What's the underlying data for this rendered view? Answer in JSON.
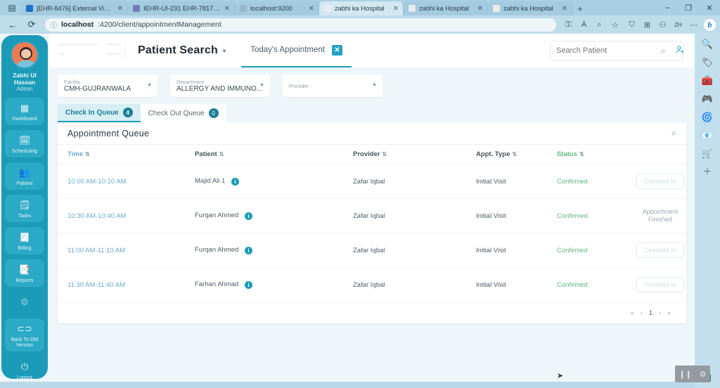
{
  "browser": {
    "tabs": [
      {
        "title": "[EHR-8476] External Visit R...",
        "favicon": "#1a73c8",
        "active": false
      },
      {
        "title": "IEHR-UI-231 EHR-7817 > I...",
        "favicon": "#6f7fb5",
        "active": false
      },
      {
        "title": "localhost:9200",
        "favicon": "#9ab5c7",
        "active": false
      },
      {
        "title": "zabhi ka Hospital",
        "favicon": "#e8edf0",
        "active": true
      },
      {
        "title": "zabhi ka Hospital",
        "favicon": "#e8edf0",
        "active": false
      },
      {
        "title": "zabhi ka Hospital",
        "favicon": "#e8edf0",
        "active": false
      }
    ],
    "new_tab_label": "+",
    "window_controls": [
      "–",
      "❐",
      "✕"
    ],
    "back_icon": "←",
    "reload_icon": "⟳",
    "info_icon": "ⓘ",
    "url_host": "localhost",
    "url_path": ":4200/client/appointmentManagement",
    "omnibox_icons": [
      "⚿",
      "A",
      "⌕",
      "☆"
    ],
    "toolbar_icons": [
      "⛉",
      "⊞",
      "⚇",
      "ZH",
      "⋯"
    ],
    "bing_label": "b"
  },
  "edge_sidebar": {
    "icons": [
      "🔍",
      "🏷",
      "🧰",
      "🎮",
      "🌀",
      "📧",
      "🛒",
      "＋"
    ]
  },
  "appnav": {
    "user_name_line1": "Zabhi Ul",
    "user_name_line2": "Hassan",
    "user_role": "Admin",
    "items": [
      {
        "label": "Dashboard",
        "icon": "▦",
        "boxed": true
      },
      {
        "label": "Scheduling",
        "icon": "🗓",
        "boxed": true
      },
      {
        "label": "Patient",
        "icon": "👥",
        "boxed": true
      },
      {
        "label": "Tasks",
        "icon": "🗒",
        "boxed": true
      },
      {
        "label": "Billing",
        "icon": "🧾",
        "boxed": true
      },
      {
        "label": "Reports",
        "icon": "📑",
        "boxed": true
      },
      {
        "label": "",
        "icon": "⚙",
        "boxed": false
      },
      {
        "label": "Back To Old Version",
        "icon": "⏻",
        "boxed": true
      },
      {
        "label": "Logout",
        "icon": "⏻",
        "boxed": false
      }
    ]
  },
  "topbar": {
    "page_title": "Patient Search",
    "title_caret": "▾",
    "todays_appointment_label": "Today's Appointment",
    "todays_appointment_close": "✕",
    "search_placeholder": "Search Patient",
    "search_value": "",
    "search_icon": "⌕",
    "add_patient_icon": "👤"
  },
  "filters": [
    {
      "label": "Facility",
      "value": "CMH-GUJRANWALA",
      "caret": "▼"
    },
    {
      "label": "Department",
      "value": "ALLERGY AND IMMUNO...",
      "caret": "▼"
    },
    {
      "label": "Provider",
      "value": "",
      "caret": "▼"
    }
  ],
  "queue_tabs": [
    {
      "label": "Check In Queue",
      "count": "4",
      "active": true
    },
    {
      "label": "Check Out Queue",
      "count": "0",
      "active": false
    }
  ],
  "card": {
    "title": "Appointment Queue",
    "search_icon": "⌕"
  },
  "table": {
    "columns": [
      "Time",
      "Patient",
      "Provider",
      "Appt. Type",
      "Status",
      ""
    ],
    "sort_glyph": "⇅",
    "info_glyph": "i",
    "rows": [
      {
        "time": "10:00 AM-10:10 AM",
        "patient": "Majid Ali 1",
        "provider": "Zafar Iqbal",
        "type": "Initial Visit",
        "status": "Confirmed",
        "action_kind": "button",
        "action": "Checked In"
      },
      {
        "time": "10:30 AM-10:40 AM",
        "patient": "Furqan Ahmed",
        "provider": "Zafar Iqbal",
        "type": "Initial Visit",
        "status": "Confirmed",
        "action_kind": "text",
        "action": "Appointment Finished"
      },
      {
        "time": "11:00 AM-11:10 AM",
        "patient": "Furqan Ahmed",
        "provider": "Zafar Iqbal",
        "type": "Initial Visit",
        "status": "Confirmed",
        "action_kind": "button",
        "action": "Checked In"
      },
      {
        "time": "11:30 AM-11:40 AM",
        "patient": "Farhan Ahmad",
        "provider": "Zafar Iqbal",
        "type": "Initial Visit",
        "status": "Confirmed",
        "action_kind": "button",
        "action": "Checked In"
      }
    ]
  },
  "pagination": {
    "first": "«",
    "prev": "‹",
    "current": "1",
    "next": "›",
    "last": "»"
  },
  "overlay": {
    "pause_icon": "❙❙",
    "gear_icon": "⚙",
    "panel_icon": "❑"
  },
  "colors": {
    "brand_teal": "#1b9bb8",
    "status_green": "#63b77e",
    "time_blue": "#6aa9cf",
    "chrome_blue": "#b9d9e8"
  }
}
